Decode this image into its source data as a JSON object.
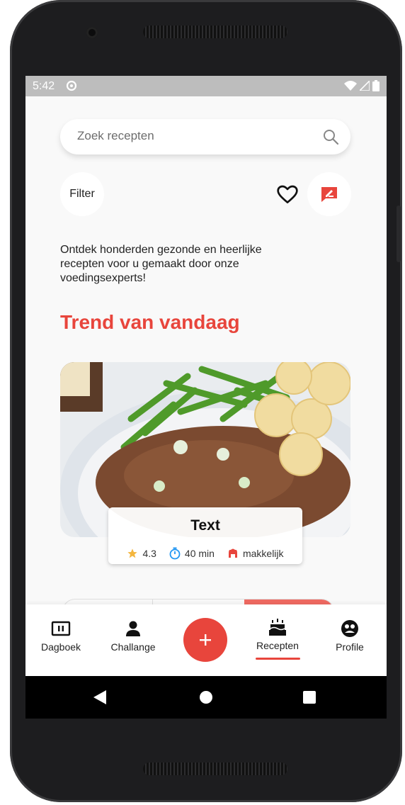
{
  "status_bar": {
    "time": "5:42"
  },
  "search": {
    "placeholder": "Zoek recepten"
  },
  "actions": {
    "filter_label": "Filter"
  },
  "intro_text": "Ontdek honderden gezonde en heerlijke recepten voor u gemaakt door onze voedingsexperts!",
  "trend": {
    "title": "Trend van vandaag",
    "recipe": {
      "name": "Text",
      "rating": "4.3",
      "time": "40 min",
      "difficulty": "makkelijk"
    }
  },
  "bottom_nav": {
    "items": [
      {
        "label": "Dagboek",
        "icon": "journal-icon"
      },
      {
        "label": "Challange",
        "icon": "person-icon"
      },
      {
        "label": "Recepten",
        "icon": "cake-icon"
      },
      {
        "label": "Profile",
        "icon": "profile-icon"
      }
    ],
    "active": "Recepten",
    "fab_icon": "plus-icon"
  },
  "colors": {
    "accent": "#e8453c",
    "star": "#f4b63f",
    "timer": "#2196f3"
  }
}
